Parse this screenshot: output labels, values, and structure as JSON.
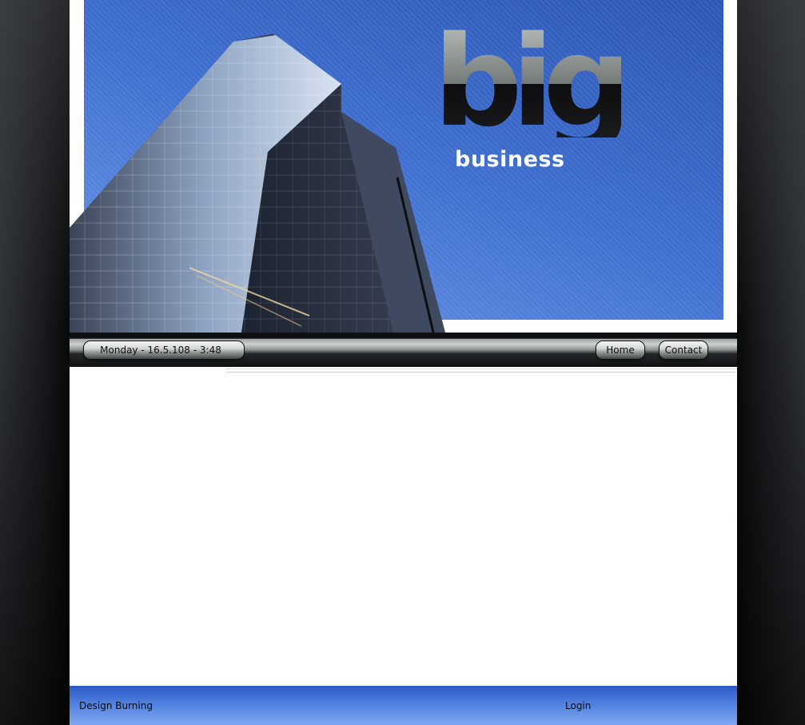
{
  "header": {
    "logo": {
      "word": "big",
      "tagline": "business"
    }
  },
  "navbar": {
    "date_text": "Monday - 16.5.108 - 3:48",
    "buttons": [
      {
        "label": "Home"
      },
      {
        "label": "Contact"
      }
    ]
  },
  "footer": {
    "credit": "Design Burning",
    "login": "Login"
  },
  "colors": {
    "sky": "#3f6fd0",
    "footer_blue": "#4f7fdf",
    "nav_silver": "#cdd2d0",
    "background": "#080909"
  }
}
